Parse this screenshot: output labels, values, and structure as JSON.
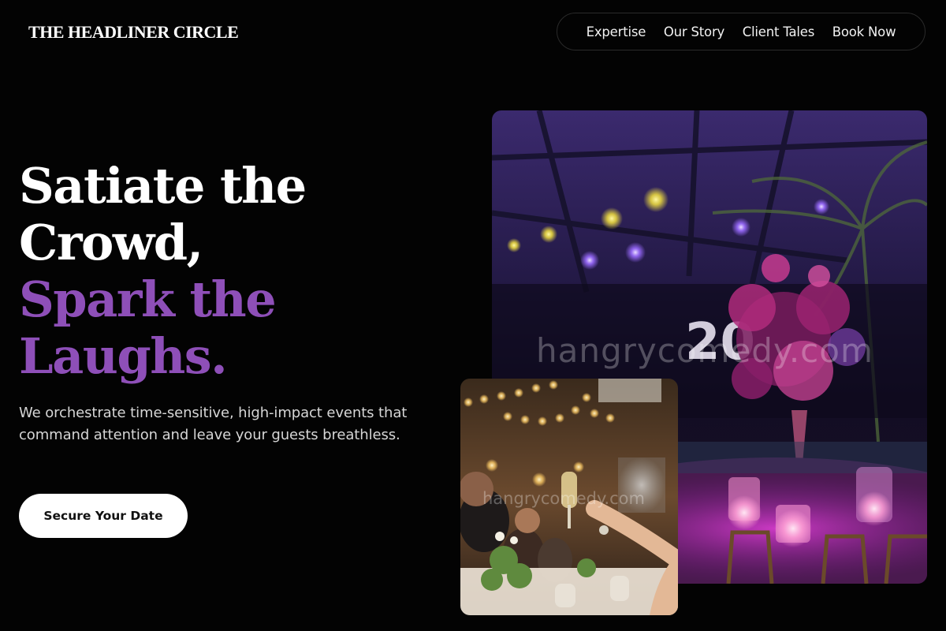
{
  "brand": {
    "name": "THE HEADLINER CIRCLE"
  },
  "nav": {
    "items": [
      {
        "label": "Expertise"
      },
      {
        "label": "Our Story"
      },
      {
        "label": "Client Tales"
      },
      {
        "label": "Book Now"
      }
    ]
  },
  "hero": {
    "headline_lines": [
      "Satiate the",
      "Crowd,",
      "Spark the",
      "Laughs."
    ],
    "subtext": "We orchestrate time-sensitive, high-impact events that command attention and leave your guests breathless.",
    "cta_label": "Secure Your Date"
  },
  "images": {
    "main_alt": "Event venue with purple stage lighting and floral table centerpiece",
    "small_alt": "Guests raising champagne glasses at a warmly lit reception",
    "watermark": "hangrycomedy.com"
  },
  "colors": {
    "accent": "#8e4fb8",
    "background": "#030303",
    "cta_bg": "#ffffff"
  }
}
